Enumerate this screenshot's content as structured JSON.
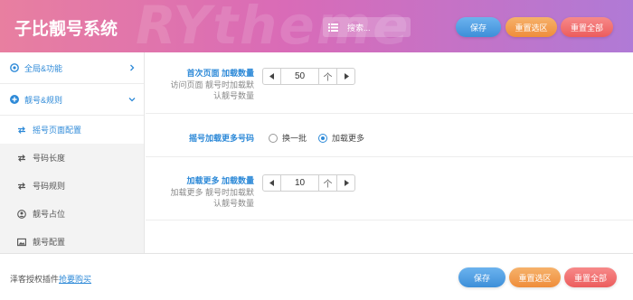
{
  "header": {
    "title": "子比靓号系统",
    "watermark": "RYtheme",
    "search_label": "搜索...",
    "save_label": "保存",
    "reset_section_label": "重置选区",
    "reset_all_label": "重置全部"
  },
  "sidebar": {
    "sections": [
      {
        "label": "全局&功能",
        "icon": "gear-icon",
        "expanded": false
      },
      {
        "label": "靓号&规则",
        "icon": "plus-circle-icon",
        "expanded": true
      }
    ],
    "items": [
      {
        "label": "摇号页面配置",
        "icon": "swap-icon",
        "active": true
      },
      {
        "label": "号码长度",
        "icon": "swap-icon",
        "active": false
      },
      {
        "label": "号码规则",
        "icon": "swap-icon",
        "active": false
      },
      {
        "label": "靓号占位",
        "icon": "user-icon",
        "active": false
      },
      {
        "label": "靓号配置",
        "icon": "image-icon",
        "active": false
      }
    ]
  },
  "main": {
    "first_load": {
      "label": "首次页面 加载数量",
      "desc_lines": [
        "访问页面 靓号时加载默",
        "认靓号数量"
      ],
      "value": "50",
      "unit": "个"
    },
    "load_more_mode": {
      "label": "摇号加载更多号码",
      "options": [
        {
          "label": "换一批",
          "selected": false
        },
        {
          "label": "加载更多",
          "selected": true
        }
      ]
    },
    "load_more_count": {
      "label": "加载更多 加载数量",
      "desc_lines": [
        "加载更多 靓号时加载默",
        "认靓号数量"
      ],
      "value": "10",
      "unit": "个"
    }
  },
  "footer": {
    "license_text": "泽客授权插件",
    "license_link": "抢要购买",
    "save_label": "保存",
    "reset_section_label": "重置选区",
    "reset_all_label": "重置全部"
  },
  "colors": {
    "accent": "#2e8ad8",
    "header_start": "#e87fa0",
    "header_end": "#b07ad6",
    "btn_blue": "#3d8fd9",
    "btn_orange": "#ef8d3a",
    "btn_red": "#ec5c5c"
  }
}
